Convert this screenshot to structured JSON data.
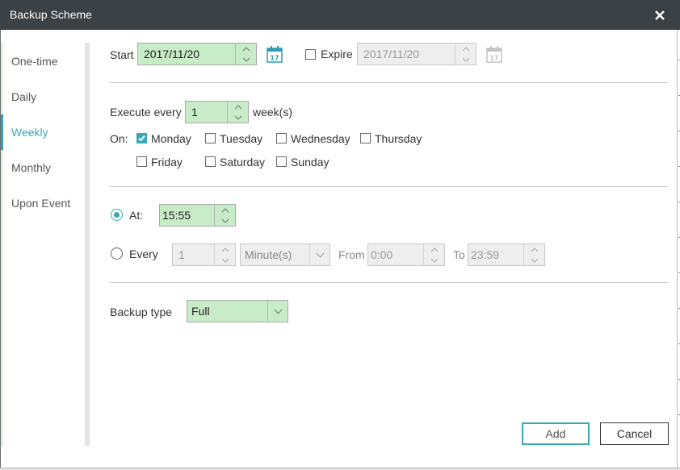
{
  "window": {
    "title": "Backup Scheme"
  },
  "sidebar": {
    "items": [
      {
        "label": "One-time"
      },
      {
        "label": "Daily"
      },
      {
        "label": "Weekly"
      },
      {
        "label": "Monthly"
      },
      {
        "label": "Upon Event"
      }
    ],
    "active": "Weekly"
  },
  "dates": {
    "start_label": "Start",
    "start_value": "2017/11/20",
    "expire_label": "Expire",
    "expire_value": "2017/11/20",
    "calendar_day": "17"
  },
  "execute": {
    "prefix": "Execute every",
    "value": "1",
    "suffix": "week(s)",
    "on_label": "On:"
  },
  "days": [
    {
      "label": "Monday",
      "checked": true
    },
    {
      "label": "Tuesday",
      "checked": false
    },
    {
      "label": "Wednesday",
      "checked": false
    },
    {
      "label": "Thursday",
      "checked": false
    },
    {
      "label": "Friday",
      "checked": false
    },
    {
      "label": "Saturday",
      "checked": false
    },
    {
      "label": "Sunday",
      "checked": false
    }
  ],
  "time": {
    "at_label": "At:",
    "at_value": "15:55",
    "every_label": "Every",
    "every_value": "1",
    "unit_value": "Minute(s)",
    "from_label": "From",
    "from_value": "0:00",
    "to_label": "To",
    "to_value": "23:59"
  },
  "backup": {
    "label": "Backup type",
    "value": "Full"
  },
  "buttons": {
    "add": "Add",
    "cancel": "Cancel"
  },
  "colors": {
    "titlebar": "#3c4145",
    "accent": "#3aa8b4",
    "field": "#c8ebc8"
  }
}
